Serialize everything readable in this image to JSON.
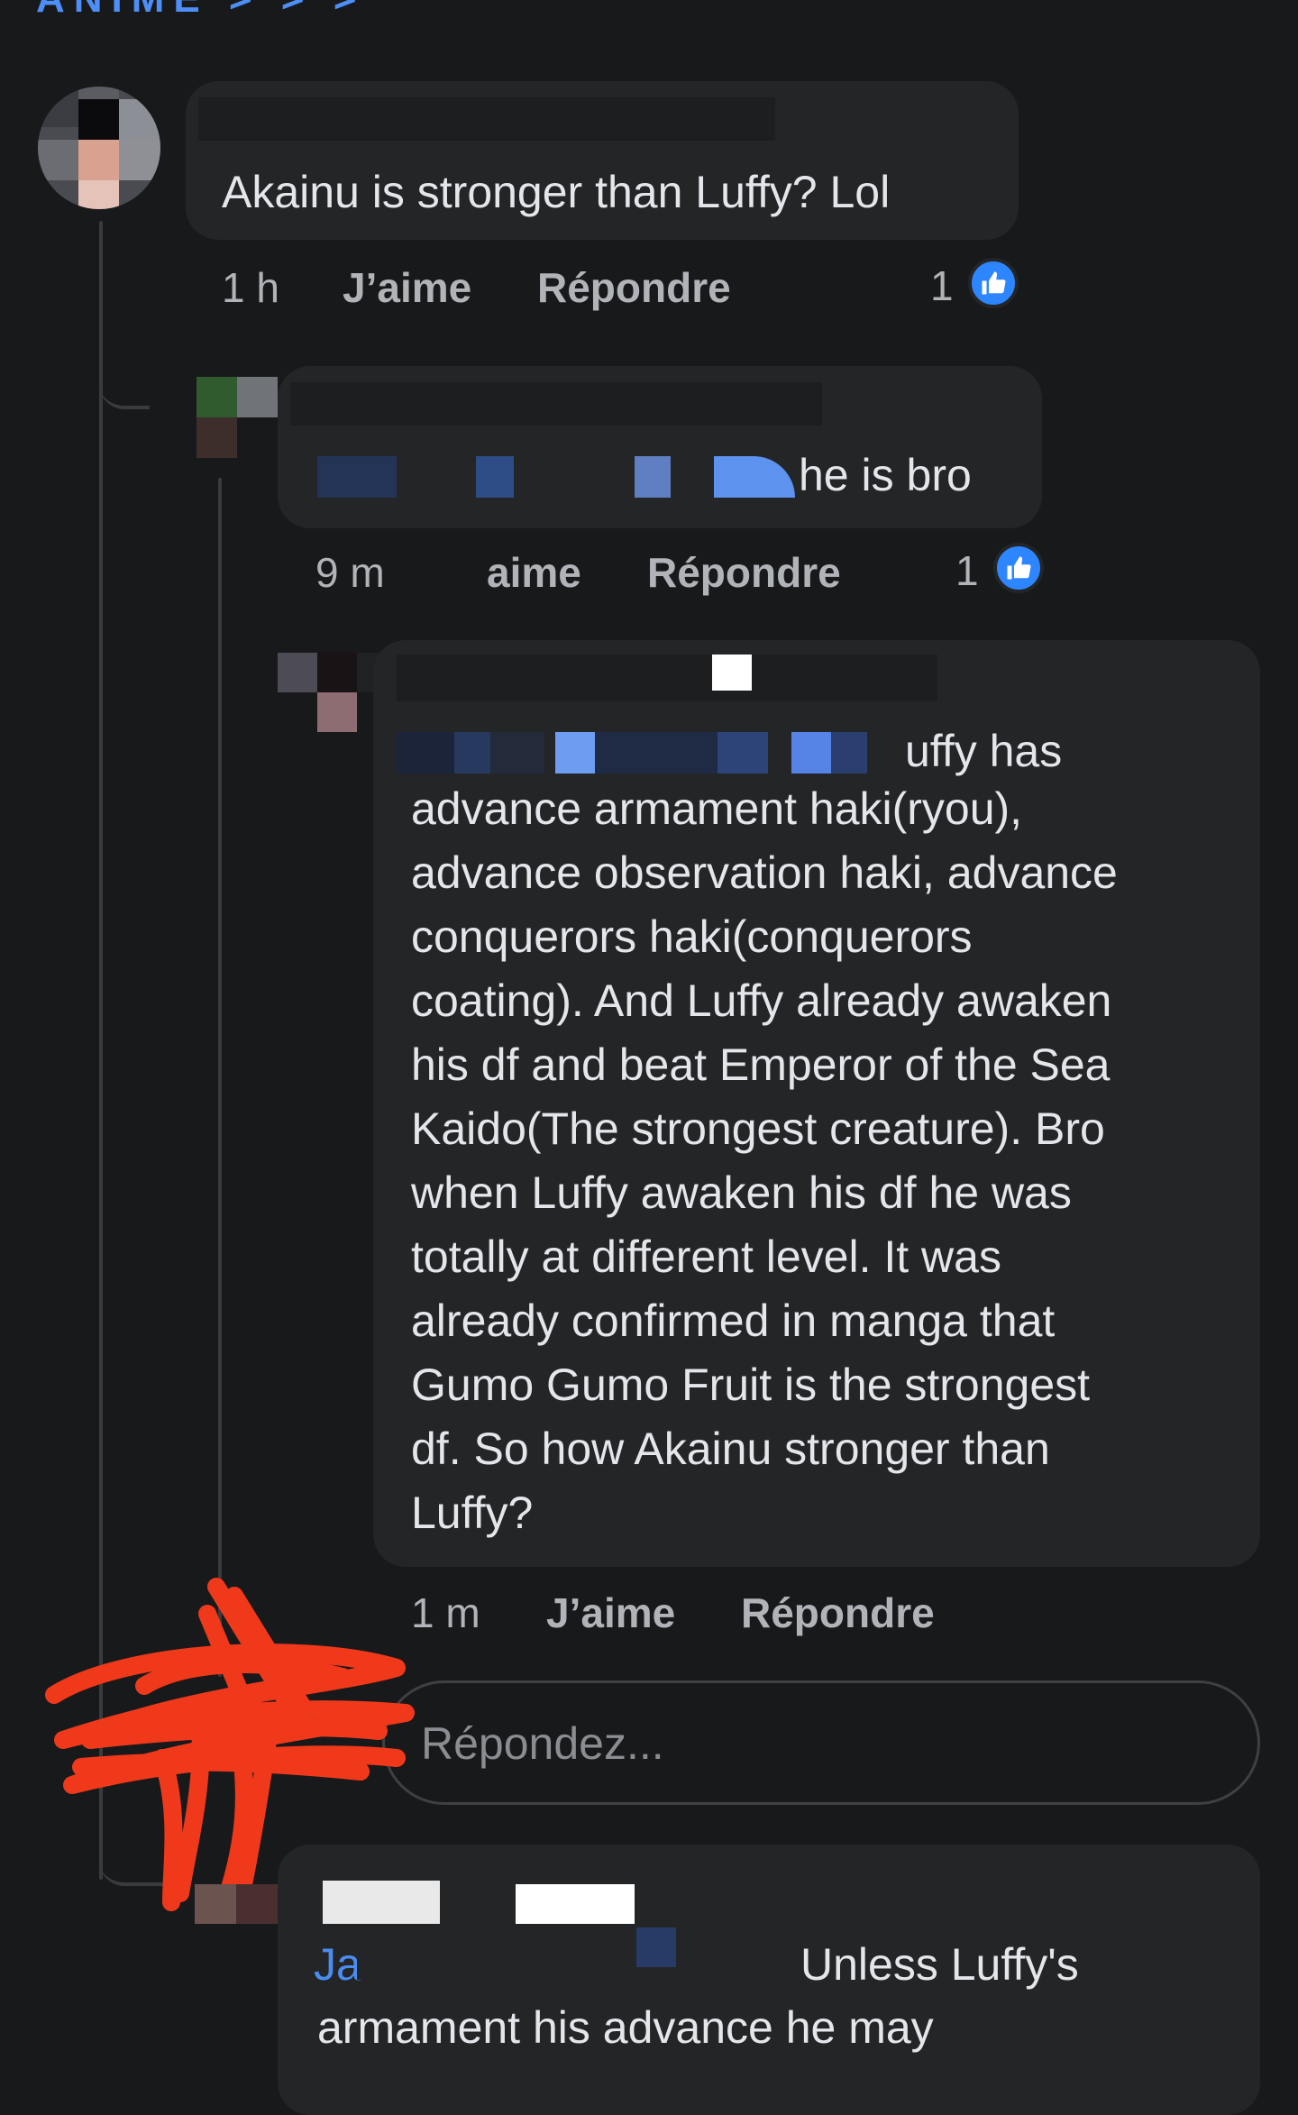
{
  "header": {
    "cut_title": "ANIME > > >"
  },
  "comments": [
    {
      "text": "Akainu is stronger than Luffy? Lol",
      "time": "1 h",
      "like_label": "J’aime",
      "reply_label": "Répondre",
      "reaction_count": "1"
    },
    {
      "text": "he is bro",
      "time": "9 m",
      "like_label": "aime",
      "reply_label": "Répondre",
      "reaction_count": "1"
    },
    {
      "text_first": "uffy has",
      "text": "advance armament haki(ryou),\nadvance observation haki, advance\nconquerors haki(conquerors\ncoating). And Luffy already awaken\nhis df and beat Emperor of the Sea\nKaido(The strongest creature). Bro\nwhen Luffy awaken his df he was\ntotally at different level. It was\nalready confirmed in manga that\nGumo Gumo Fruit is the strongest\ndf. So how Akainu stronger than\nLuffy?",
      "time": "1 m",
      "like_label": "J’aime",
      "reply_label": "Répondre"
    },
    {
      "mention_start": "Ja",
      "text_first": "Unless Luffy's",
      "text": "armament his advance he may"
    }
  ],
  "reply_box": {
    "placeholder": "Répondez..."
  },
  "colors": {
    "background": "#18191a",
    "bubble": "#242526",
    "accent": "#2d86ff",
    "scribble": "#f0391a"
  }
}
